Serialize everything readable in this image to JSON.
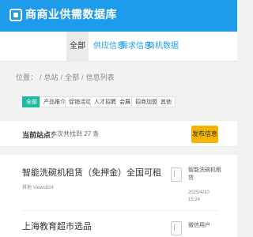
{
  "header": {
    "logo_text": "商商业供需数据库"
  },
  "nav": {
    "items": [
      {
        "label": "全部",
        "active": true
      },
      {
        "label": "供应信息",
        "active": false
      },
      {
        "label": "需求信息",
        "active": false
      },
      {
        "label": "商机数据",
        "active": false
      }
    ]
  },
  "breadcrumb": [
    "位置：",
    "/",
    "总站",
    "/",
    "全部",
    "/",
    "信息列表"
  ],
  "filters": [
    "全部",
    "产品推介",
    "促销活动",
    "人才招聘",
    "会展",
    "招商加盟",
    "其他"
  ],
  "results": {
    "site_label": "当前站点：",
    "count_text": "本次共找到 27 条",
    "publish_label": "发布信息"
  },
  "listings": [
    {
      "title": "智能洗碗机租赁（免押金）全国可租",
      "meta": "其他 Views824",
      "author_line1": "智能洗碗机租",
      "author_line2": "赁",
      "date": "2025/4/10 15:24"
    },
    {
      "title": "上海教育超市选品",
      "meta": "",
      "author_line1": "微信用户",
      "author_line2": "",
      "date": ""
    }
  ],
  "icons": {
    "logo": "logo-icon",
    "avatar": "document-icon"
  },
  "colors": {
    "brand": "#1e9bea",
    "chip_active": "#1eb99e",
    "publish": "#f5b400"
  }
}
